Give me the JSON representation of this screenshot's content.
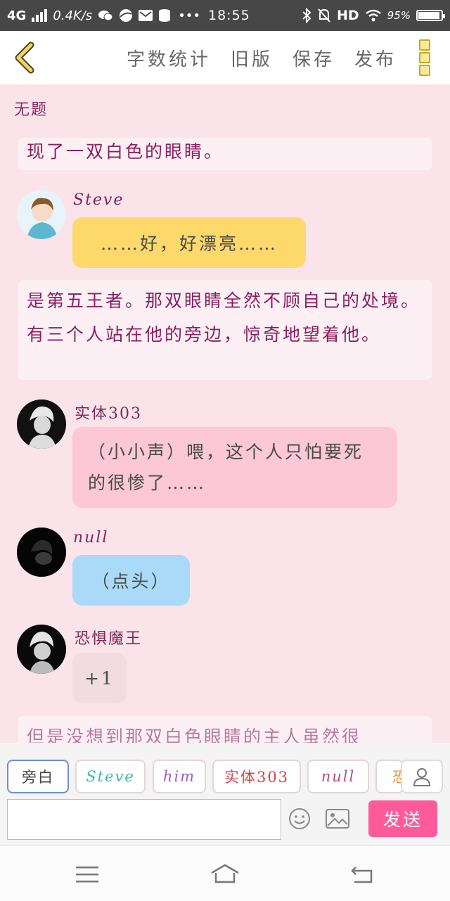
{
  "status_bar": {
    "network": "4G",
    "speed": "0.4K/s",
    "time": "18:55",
    "hd": "HD",
    "battery_text": "95%",
    "battery_level": 0.95
  },
  "toolbar": {
    "word_count": "字数统计",
    "old_version": "旧版",
    "save": "保存",
    "publish": "发布"
  },
  "doc": {
    "title": "无题"
  },
  "story": [
    {
      "kind": "narration",
      "text": "现了一双白色的眼睛。"
    },
    {
      "kind": "dialogue",
      "speaker": "Steve",
      "text": "……好，好漂亮……",
      "color": "#fdd96b"
    },
    {
      "kind": "narration",
      "text": "是第五王者。那双眼睛全然不顾自己的处境。有三个人站在他的旁边，惊奇地望着他。"
    },
    {
      "kind": "dialogue",
      "speaker": "实体303",
      "text": "（小小声）喂，这个人只怕要死的很惨了……",
      "color": "#fcc7d6"
    },
    {
      "kind": "dialogue",
      "speaker": "null",
      "text": "（点头）",
      "color": "#a9dbf8"
    },
    {
      "kind": "dialogue",
      "speaker": "恐惧魔王",
      "text": "+1",
      "color": "#f0dce1"
    },
    {
      "kind": "narration",
      "text": "但是没想到那双白色眼睛的主人虽然很"
    }
  ],
  "role_chips": [
    {
      "label": "旁白",
      "color": "#444444"
    },
    {
      "label": "Steve",
      "color": "#3fb3ad"
    },
    {
      "label": "him",
      "color": "#a05bc6"
    },
    {
      "label": "实体303",
      "color": "#d2444e"
    },
    {
      "label": "null",
      "color": "#b04a8a"
    },
    {
      "label": "恐",
      "color": "#e8913b"
    }
  ],
  "input": {
    "value": "",
    "placeholder": ""
  },
  "send_label": "发送"
}
